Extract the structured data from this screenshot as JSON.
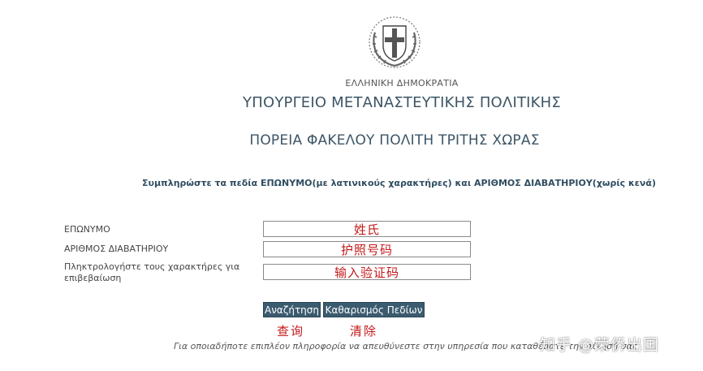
{
  "header": {
    "republic": "ΕΛΛΗΝΙΚΗ ΔΗΜΟΚΡΑΤΙΑ",
    "ministry": "ΥΠΟΥΡΓΕΙΟ ΜΕΤΑΝΑΣΤΕΥΤΙΚΗΣ ΠΟΛΙΤΙΚΗΣ",
    "service": "ΠΟΡΕΙΑ ΦΑΚΕΛΟΥ ΠΟΛΙΤΗ ΤΡΙΤΗΣ ΧΩΡΑΣ"
  },
  "instruction": "Συμπληρώστε τα πεδία ΕΠΩΝΥΜΟ(με λατινικούς χαρακτήρες) και ΑΡΙΘΜΟΣ ΔΙΑΒΑΤΗΡΙΟΥ(χωρίς κενά)",
  "form": {
    "surname": {
      "label": "ΕΠΩΝΥΜΟ",
      "value": "姓氏"
    },
    "passport": {
      "label": "ΑΡΙΘΜΟΣ ΔΙΑΒΑΤΗΡΙΟΥ",
      "value": "护照号码"
    },
    "captcha": {
      "label": "Πληκτρολογήστε τους χαρακτήρες για επιβεβαίωση",
      "value": "输入验证码"
    }
  },
  "buttons": {
    "search": "Αναζήτηση",
    "clear": "Καθαρισμός Πεδίων"
  },
  "annotations": {
    "search": "查询",
    "clear": "清除"
  },
  "footer": "Για οποιαδήποτε επιπλέον πληροφορία να απευθύνεστε στην υπηρεσία που καταθέσατε την αίτησή σας",
  "watermark": "知乎 @荣侨出国",
  "colors": {
    "title": "#3d5566",
    "button_bg": "#3b5b6f",
    "annotation_red": "#c4191a"
  },
  "icons": {
    "emblem": "greek-coat-of-arms-icon"
  }
}
